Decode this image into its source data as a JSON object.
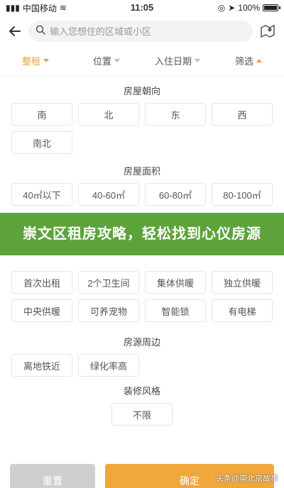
{
  "status": {
    "carrier": "中国移动",
    "time": "11:05",
    "battery": "100%"
  },
  "search": {
    "placeholder": "输入您想住的区域或小区"
  },
  "tabs": [
    {
      "label": "整租"
    },
    {
      "label": "位置"
    },
    {
      "label": "入住日期"
    },
    {
      "label": "筛选"
    }
  ],
  "sections": {
    "orientation": {
      "title": "房屋朝向",
      "options": [
        "南",
        "北",
        "东",
        "西",
        "南北"
      ]
    },
    "area": {
      "title": "房屋面积",
      "options": [
        "40㎡以下",
        "40-60㎡",
        "60-80㎡",
        "80-100㎡"
      ]
    },
    "features": {
      "options": [
        "首次出租",
        "2个卫生间",
        "集体供暖",
        "独立供暖",
        "中央供暖",
        "可养宠物",
        "智能锁",
        "有电梯"
      ]
    },
    "surroundings": {
      "title": "房源周边",
      "options": [
        "离地铁近",
        "绿化率高"
      ]
    },
    "decoration": {
      "title": "装修风格",
      "options": [
        "不限"
      ]
    }
  },
  "banner": {
    "text": "崇文区租房攻略，轻松找到心仪房源"
  },
  "buttons": {
    "reset": "重置",
    "confirm": "确定"
  },
  "watermark": "头条@崇北京故事"
}
